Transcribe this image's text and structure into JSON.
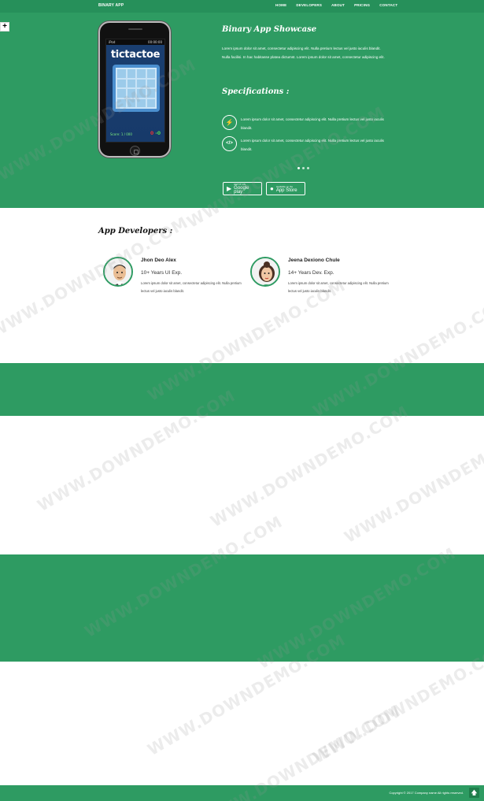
{
  "navbar": {
    "brand": "BINARY APP",
    "links": [
      "HOME",
      "DEVELOPERS",
      "ABOUT",
      "PRICING",
      "CONTACT"
    ]
  },
  "expand_label": "+",
  "phone": {
    "carrier": "iPod",
    "time": "00:00:00",
    "app_title": "tictactoe",
    "score_left": "Score: 1 / 000",
    "score_a": "0",
    "score_b": "-0"
  },
  "showcase": {
    "title": "Binary App Showcase",
    "text": "Lorem ipsum dolor sit amet, consectetur adipiscing elit. Nulla pretium lectus vel justo iaculis blandit. Nulla facilisi. In hac habitasse platea dictumst. Lorem ipsum dolor sit amet, consectetur adipiscing elit."
  },
  "specifications": {
    "title": "Specifications :",
    "items": [
      {
        "icon": "lightning-icon",
        "glyph": "⚡",
        "text": "Lorem ipsum dolor sit amet, consectetur adipiscing elit. Nulla pretium lectus vel justo iaculis blandit."
      },
      {
        "icon": "code-icon",
        "glyph": "</>",
        "text": "Lorem ipsum dolor sit amet, consectetur adipiscing elit. Nulla pretium lectus vel justo iaculis blandit."
      }
    ]
  },
  "stores": {
    "google_small": "GET IT ON",
    "google_big": "Google play",
    "apple_small": "Available on the",
    "apple_big": "App Store"
  },
  "developers": {
    "title": "App Developers :",
    "people": [
      {
        "name": "Jhon Deo Alex",
        "experience": "10+ Years UI Exp.",
        "description": "Lorem ipsum dolor sit amet, consectetur adipiscing elit. Nulla pretium lectus vel justo iaculis blandit."
      },
      {
        "name": "Jeena Dexiono Chule",
        "experience": "14+ Years Dev. Exp.",
        "description": "Lorem ipsum dolor sit amet, consectetur adipiscing elit. Nulla pretium lectus vel justo iaculis blandit."
      }
    ]
  },
  "footer": {
    "copyright": "Copyright © 2017 Company name All rights reserved.",
    "top_glyph": "🡅"
  },
  "watermark": "WWW.DOWNDEMO.COM",
  "colors": {
    "brand_green": "#2e9b62",
    "navbar_green": "#26905a"
  }
}
